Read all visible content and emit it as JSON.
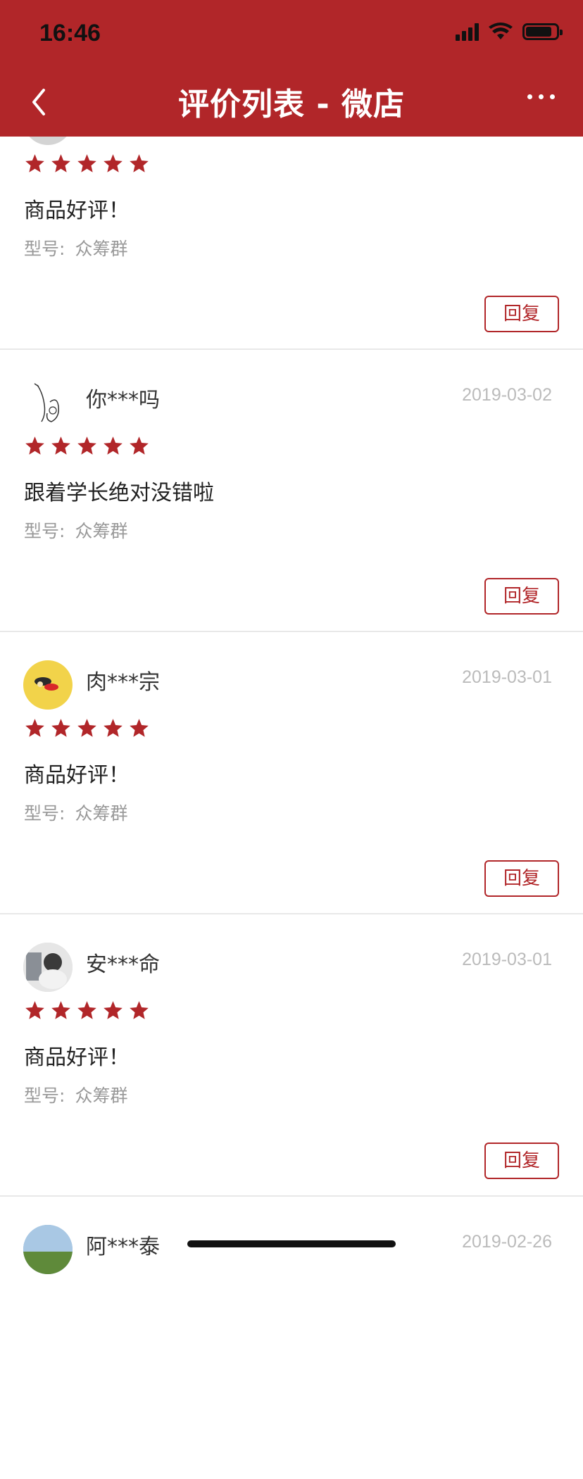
{
  "status_bar": {
    "time": "16:46"
  },
  "nav": {
    "title": "评价列表 - 微店"
  },
  "colors": {
    "accent": "#b12629",
    "date": "#bbbbbb",
    "model": "#999999"
  },
  "reviews": [
    {
      "username": "",
      "date": "",
      "rating": 5,
      "content": "商品好评！",
      "model_label": "型号:",
      "model_value": "众筹群",
      "reply_label": "回复"
    },
    {
      "username": "你***吗",
      "date": "2019-03-02",
      "rating": 5,
      "content": "跟着学长绝对没错啦",
      "model_label": "型号:",
      "model_value": "众筹群",
      "reply_label": "回复"
    },
    {
      "username": "肉***宗",
      "date": "2019-03-01",
      "rating": 5,
      "content": "商品好评！",
      "model_label": "型号:",
      "model_value": "众筹群",
      "reply_label": "回复"
    },
    {
      "username": "安***命",
      "date": "2019-03-01",
      "rating": 5,
      "content": "商品好评！",
      "model_label": "型号:",
      "model_value": "众筹群",
      "reply_label": "回复"
    },
    {
      "username": "阿***泰",
      "date": "2019-02-26"
    }
  ]
}
